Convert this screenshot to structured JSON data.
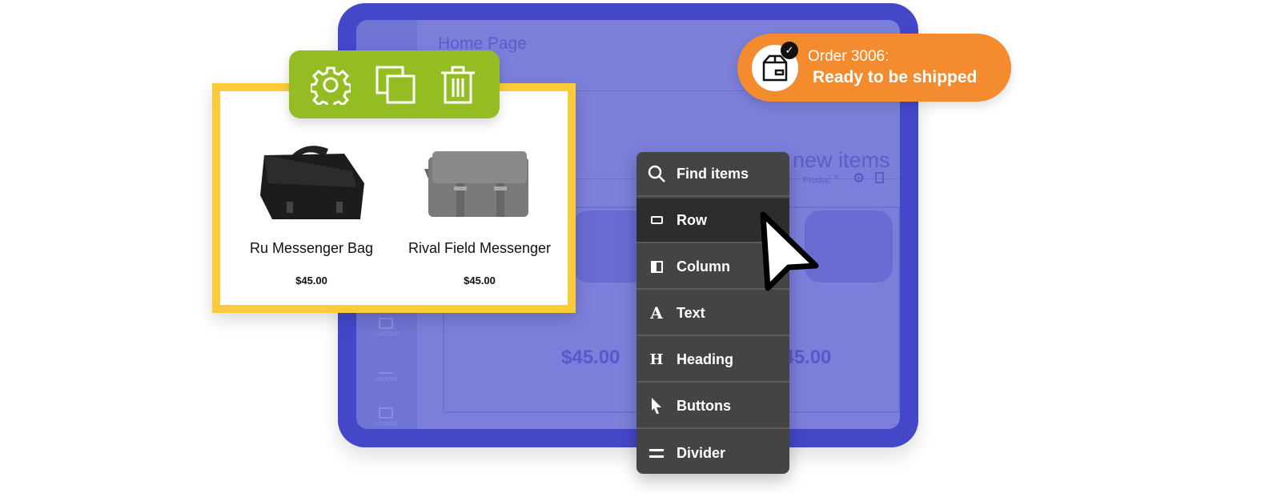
{
  "background_page": {
    "title": "Home Page",
    "section_heading": "new items",
    "toolbar_label": "Produc",
    "toolbar_suffix": "'s",
    "prices": [
      "$45.00",
      "$45.00"
    ],
    "sidebar": [
      "CONTENT",
      "REPORT",
      "STORES"
    ]
  },
  "product_card": {
    "actions": [
      {
        "icon": "gear-icon"
      },
      {
        "icon": "duplicate-icon"
      },
      {
        "icon": "trash-icon"
      }
    ],
    "products": [
      {
        "name": "Ru Messenger Bag",
        "price": "$45.00"
      },
      {
        "name": "Rival Field Messenger",
        "price": "$45.00"
      }
    ]
  },
  "notification": {
    "line1": "Order 3006:",
    "line2": "Ready to be shipped",
    "icon": "package-check-icon"
  },
  "insert_menu": {
    "items": [
      {
        "label": "Find items",
        "icon": "search-icon"
      },
      {
        "label": "Row",
        "icon": "row-icon",
        "selected": true
      },
      {
        "label": "Column",
        "icon": "column-icon"
      },
      {
        "label": "Text",
        "icon": "text-icon"
      },
      {
        "label": "Heading",
        "icon": "heading-icon"
      },
      {
        "label": "Buttons",
        "icon": "pointer-icon"
      },
      {
        "label": "Divider",
        "icon": "divider-icon"
      }
    ]
  },
  "colors": {
    "frame": "#4347c8",
    "panel": "#7b7fd9",
    "card_border": "#fdcb3a",
    "action_bar": "#93bd22",
    "notification": "#f48c2f",
    "menu": "#444444"
  }
}
